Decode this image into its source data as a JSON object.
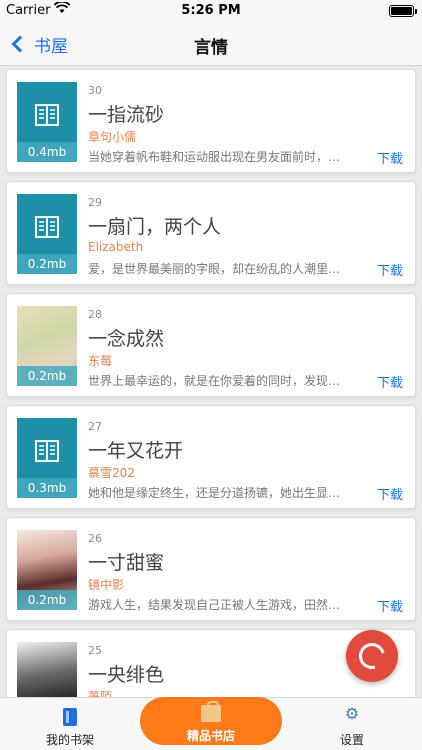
{
  "statusbar": {
    "carrier": "Carrier",
    "time": "5:26 PM"
  },
  "navbar": {
    "back_label": "书屋",
    "title": "言情"
  },
  "books": [
    {
      "num": "30",
      "title": "一指流砂",
      "author": "章句小儒",
      "desc": "当她穿着帆布鞋和运动服出现在男友面前时，…",
      "size": "0.4mb",
      "download": "下载",
      "cover": "book-icon"
    },
    {
      "num": "29",
      "title": "一扇门，两个人",
      "author": "Elizabeth",
      "desc": "爱，是世界最美丽的字眼，却在纷乱的人潮里…",
      "size": "0.2mb",
      "download": "下载",
      "cover": "book-icon"
    },
    {
      "num": "28",
      "title": "一念成然",
      "author": "东莓",
      "desc": "世界上最幸运的，就是在你爱着的同时，发现…",
      "size": "0.2mb",
      "download": "下载",
      "cover": "image"
    },
    {
      "num": "27",
      "title": "一年又花开",
      "author": "慕雪202",
      "desc": "她和他是缘定终生，还是分道扬镳，她出生显…",
      "size": "0.3mb",
      "download": "下载",
      "cover": "book-icon"
    },
    {
      "num": "26",
      "title": "一寸甜蜜",
      "author": "镜中影",
      "desc": "游戏人生，结果发现自己正被人生游戏，田然…",
      "size": "0.2mb",
      "download": "下载",
      "cover": "image"
    },
    {
      "num": "25",
      "title": "一央绯色",
      "author": "萋陌",
      "desc": "",
      "size": "",
      "download": "",
      "cover": "image"
    }
  ],
  "tabbar": {
    "left": "我的书架",
    "mid": "精品书店",
    "right": "设置"
  },
  "colors": {
    "accent": "#1a73e8",
    "author": "#e2844f",
    "tab_active": "#ff7b19",
    "fab": "#e34a3e",
    "cover": "#1f8ea9"
  }
}
